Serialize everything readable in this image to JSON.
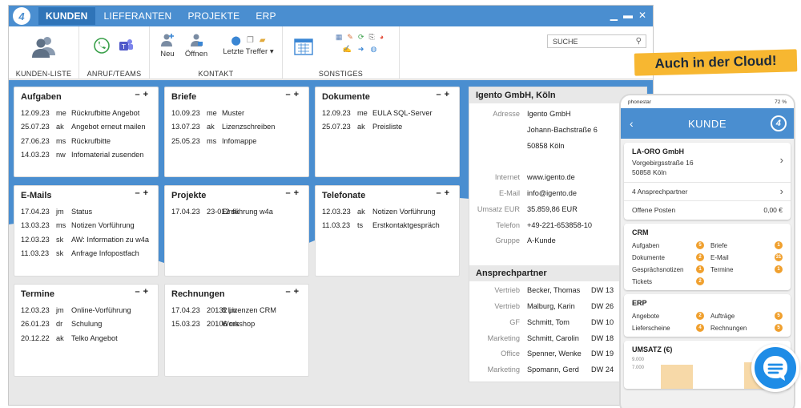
{
  "nav": {
    "tabs": [
      "KUNDEN",
      "LIEFERANTEN",
      "PROJEKTE",
      "ERP"
    ]
  },
  "ribbon": {
    "kundenliste": "KUNDEN-LISTE",
    "anruf": "ANRUF/TEAMS",
    "neu": "Neu",
    "oeffnen": "Öffnen",
    "letzte": "Letzte Treffer ▾",
    "kontakt": "KONTAKT",
    "sonstiges": "SONSTIGES",
    "search_placeholder": "SUCHE"
  },
  "cards": {
    "aufgaben": {
      "title": "Aufgaben",
      "rows": [
        [
          "12.09.23",
          "me",
          "Rückrufbitte Angebot"
        ],
        [
          "25.07.23",
          "ak",
          "Angebot erneut mailen"
        ],
        [
          "27.06.23",
          "ms",
          "Rückrufbitte"
        ],
        [
          "14.03.23",
          "nw",
          "Infomaterial zusenden"
        ]
      ]
    },
    "briefe": {
      "title": "Briefe",
      "rows": [
        [
          "10.09.23",
          "me",
          "Muster"
        ],
        [
          "13.07.23",
          "ak",
          "Lizenzschreiben"
        ],
        [
          "25.05.23",
          "ms",
          "Infomappe"
        ]
      ]
    },
    "dokumente": {
      "title": "Dokumente",
      "rows": [
        [
          "12.09.23",
          "me",
          "EULA SQL-Server"
        ],
        [
          "25.07.23",
          "ak",
          "Preisliste"
        ]
      ]
    },
    "emails": {
      "title": "E-Mails",
      "rows": [
        [
          "17.04.23",
          "jm",
          "Status"
        ],
        [
          "13.03.23",
          "ms",
          "Notizen Vorführung"
        ],
        [
          "12.03.23",
          "sk",
          "AW: Information zu w4a"
        ],
        [
          "11.03.23",
          "sk",
          "Anfrage Infopostfach"
        ]
      ]
    },
    "projekte": {
      "title": "Projekte",
      "rows": [
        [
          "17.04.23",
          "23-012 sk",
          "Einführung w4a"
        ]
      ]
    },
    "telefonate": {
      "title": "Telefonate",
      "rows": [
        [
          "12.03.23",
          "ak",
          "Notizen Vorführung"
        ],
        [
          "11.03.23",
          "ts",
          "Erstkontaktgespräch"
        ]
      ]
    },
    "termine": {
      "title": "Termine",
      "rows": [
        [
          "12.03.23",
          "jm",
          "Online-Vorführung"
        ],
        [
          "26.01.23",
          "dr",
          "Schulung"
        ],
        [
          "20.12.22",
          "ak",
          "Telko Angebot"
        ]
      ]
    },
    "rechnungen": {
      "title": "Rechnungen",
      "rows": [
        [
          "17.04.23",
          "20132 jm",
          "8 Lizenzen CRM"
        ],
        [
          "15.03.23",
          "20106 ms",
          "Workshop"
        ]
      ]
    }
  },
  "detail": {
    "title": "Igento GmbH, Köln",
    "rows": [
      {
        "label": "Adresse",
        "value": "Igento GmbH"
      },
      {
        "label": "",
        "value": "Johann-Bachstraße 6"
      },
      {
        "label": "",
        "value": "50858 Köln"
      },
      {
        "label": "",
        "value": ""
      },
      {
        "label": "Internet",
        "value": "www.igento.de"
      },
      {
        "label": "E-Mail",
        "value": "info@igento.de"
      },
      {
        "label": "Umsatz EUR",
        "value": "35.859,86 EUR"
      },
      {
        "label": "Telefon",
        "value": "+49-221-653858-10"
      },
      {
        "label": "Gruppe",
        "value": "A-Kunde"
      }
    ],
    "contacts_title": "Ansprechpartner",
    "contacts": [
      {
        "role": "Vertrieb",
        "name": "Becker, Thomas",
        "ext": "DW 13"
      },
      {
        "role": "Vertrieb",
        "name": "Malburg, Karin",
        "ext": "DW 26"
      },
      {
        "role": "GF",
        "name": "Schmitt, Tom",
        "ext": "DW 10"
      },
      {
        "role": "Marketing",
        "name": "Schmitt, Carolin",
        "ext": "DW 18"
      },
      {
        "role": "Office",
        "name": "Spenner, Wenke",
        "ext": "DW 19"
      },
      {
        "role": "Marketing",
        "name": "Spomann, Gerd",
        "ext": "DW 24"
      }
    ]
  },
  "banner": "Auch in der Cloud!",
  "phone": {
    "carrier": "phonestar",
    "battery": "72 %",
    "title": "KUNDE",
    "company": "LA-ORO GmbH",
    "street": "Vorgebirgsstraße 16",
    "city": "50858 Köln",
    "contacts": "4 Ansprechpartner",
    "open_label": "Offene Posten",
    "open_value": "0,00 €",
    "crm_title": "CRM",
    "crm": [
      {
        "l": "Aufgaben",
        "b": "5"
      },
      {
        "l": "Briefe",
        "b": "1"
      },
      {
        "l": "Dokumente",
        "b": "2"
      },
      {
        "l": "E-Mail",
        "b": "31"
      },
      {
        "l": "Gesprächsnotizen",
        "b": "1"
      },
      {
        "l": "Termine",
        "b": "1"
      },
      {
        "l": "Tickets",
        "b": "2"
      }
    ],
    "erp_title": "ERP",
    "erp": [
      {
        "l": "Angebote",
        "b": "2"
      },
      {
        "l": "Aufträge",
        "b": "5"
      },
      {
        "l": "Lieferscheine",
        "b": "4"
      },
      {
        "l": "Rechnungen",
        "b": "5"
      }
    ],
    "umsatz_title": "UMSATZ (€)",
    "umsatz_ticks": [
      "9.000",
      "7.000"
    ]
  },
  "colors": {
    "accent": "#4a8ed0",
    "banner": "#f7b731",
    "badge": "#f0a02e"
  }
}
